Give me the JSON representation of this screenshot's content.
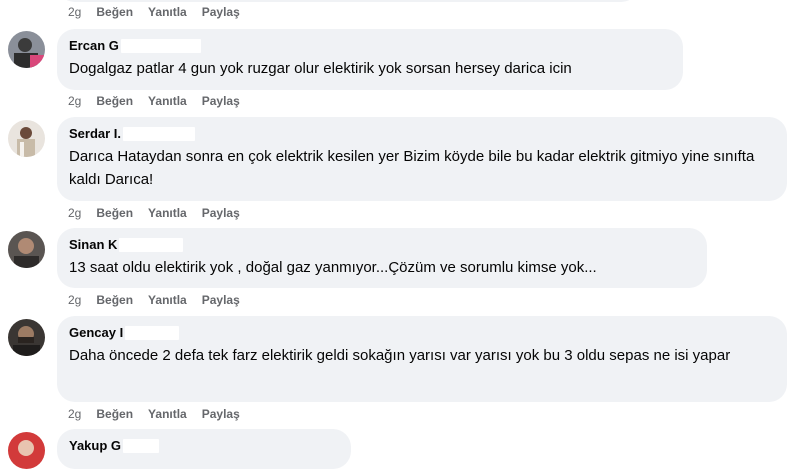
{
  "action_labels": {
    "like": "Beğen",
    "reply": "Yanıtla",
    "share": "Paylaş"
  },
  "top_actions": {
    "time": "2g"
  },
  "comments": [
    {
      "author": "Ercan G",
      "text": "Dogalgaz patlar 4 gun yok ruzgar olur elektirik yok sorsan hersey darica icin",
      "time": "2g"
    },
    {
      "author": "Serdar I.",
      "text": "Darıca Hataydan sonra en çok elektrik kesilen yer Bizim köyde bile bu kadar elektrik gitmiyo yine sınıfta kaldı Darıca!",
      "time": "2g"
    },
    {
      "author": "Sinan K",
      "text": "13 saat oldu elektirik yok , doğal gaz yanmıyor...Çözüm ve sorumlu kimse yok...",
      "time": "2g"
    },
    {
      "author": "Gencay I",
      "text": "Daha öncede 2 defa tek farz elektirik geldi sokağın yarısı var yarısı yok bu 3 oldu sepas ne isi yapar",
      "time": "2g"
    },
    {
      "author": "Yakup G",
      "text": "",
      "time": ""
    }
  ],
  "colors": {
    "bubble": "#f0f2f5",
    "meta": "#65676b",
    "text": "#050505"
  }
}
